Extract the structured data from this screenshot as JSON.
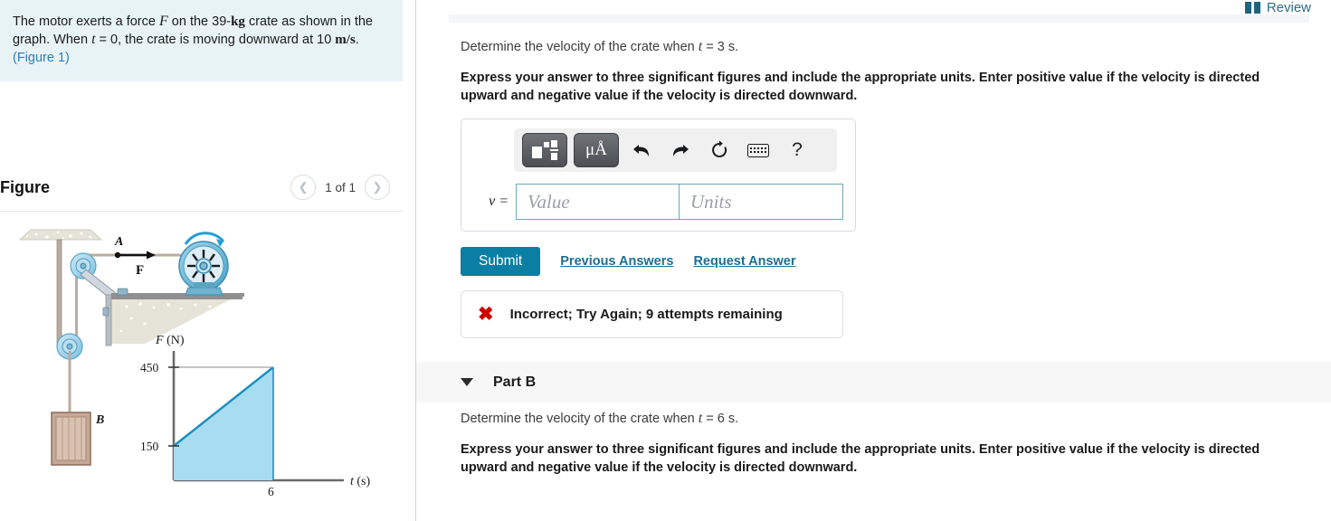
{
  "left": {
    "problem": {
      "pre": "The motor exerts a force ",
      "force_symbol": "F",
      "mid1": " on the 39-",
      "mass_unit": "kg",
      "mid2": " crate as shown in the graph. When ",
      "t_symbol": "t",
      "mid3": " = 0, the crate is moving downward at 10 ",
      "speed_unit": "m/s",
      "period": ". ",
      "figure_link": "(Figure 1)"
    },
    "figure": {
      "title": "Figure",
      "prev_icon": "chevron-left-icon",
      "next_icon": "chevron-right-icon",
      "counter": "1 of 1",
      "labels": {
        "point_a": "A",
        "force": "F",
        "crate": "B"
      }
    }
  },
  "header": {
    "review_label": "Review",
    "review_icon": "book-icon"
  },
  "partA": {
    "question": {
      "pre": "Determine the velocity of the crate when ",
      "t_symbol": "t",
      "post": " = 3 s."
    },
    "instructions": "Express your answer to three significant figures and include the appropriate units. Enter positive value if the velocity is directed upward and negative value if the velocity is directed downward.",
    "toolbar": {
      "template_icon": "math-template-icon",
      "units_icon": "micro-angstrom-units-icon",
      "units_label": "μÅ",
      "undo_icon": "undo-icon",
      "redo_icon": "redo-icon",
      "reset_icon": "reset-icon",
      "keyboard_icon": "keyboard-icon",
      "help_icon": "help-icon",
      "help_label": "?"
    },
    "answer": {
      "variable_label": "v =",
      "value_placeholder": "Value",
      "value": "",
      "units_placeholder": "Units",
      "units": ""
    },
    "actions": {
      "submit_label": "Submit",
      "previous_answers_label": "Previous Answers",
      "request_answer_label": "Request Answer"
    },
    "feedback": {
      "icon": "x-mark-icon",
      "text": "Incorrect; Try Again; 9 attempts remaining"
    }
  },
  "partB": {
    "caret_icon": "caret-down-icon",
    "label": "Part B",
    "question": {
      "pre": "Determine the velocity of the crate when ",
      "t_symbol": "t",
      "post": " = 6 s."
    },
    "instructions": "Express your answer to three significant figures and include the appropriate units. Enter positive value if the velocity is directed upward and negative value if the velocity is directed downward."
  },
  "chart_data": {
    "type": "line",
    "title": "",
    "xlabel": "t (s)",
    "ylabel": "F (N)",
    "x": [
      0,
      6
    ],
    "values": [
      150,
      450
    ],
    "xticks": [
      "6"
    ],
    "yticks": [
      "150",
      "450"
    ],
    "xlim": [
      0,
      8.5
    ],
    "ylim": [
      0,
      520
    ],
    "grid": false,
    "fill": true,
    "fill_color": "#a8dcf0",
    "line_color": "#1a8fc1",
    "legend": "none",
    "annotations": [
      "Linear force ramp from 150 N at t = 0 to 450 N at t = 6 s"
    ]
  },
  "colors": {
    "accent": "#0b7ea4",
    "link": "#1c6f94",
    "problem_bg": "#e8f3f6",
    "error": "#cc0000",
    "chart_fill": "#a8dcf0",
    "chart_line": "#1a8fc1"
  }
}
